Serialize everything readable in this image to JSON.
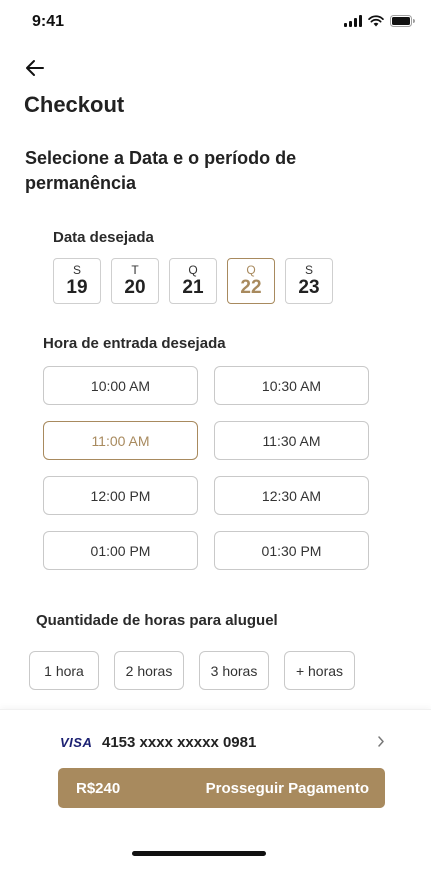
{
  "status_bar": {
    "time": "9:41"
  },
  "header": {
    "title": "Checkout"
  },
  "section": {
    "title": "Selecione a Data e o período de permanência"
  },
  "date_picker": {
    "label": "Data desejada",
    "dates": [
      {
        "dow": "S",
        "day": "19",
        "selected": false
      },
      {
        "dow": "T",
        "day": "20",
        "selected": false
      },
      {
        "dow": "Q",
        "day": "21",
        "selected": false
      },
      {
        "dow": "Q",
        "day": "22",
        "selected": true
      },
      {
        "dow": "S",
        "day": "23",
        "selected": false
      }
    ]
  },
  "time_picker": {
    "label": "Hora de entrada desejada",
    "times": [
      {
        "label": "10:00 AM",
        "selected": false
      },
      {
        "label": "10:30 AM",
        "selected": false
      },
      {
        "label": "11:00 AM",
        "selected": true
      },
      {
        "label": "11:30 AM",
        "selected": false
      },
      {
        "label": "12:00 PM",
        "selected": false
      },
      {
        "label": "12:30 AM",
        "selected": false
      },
      {
        "label": "01:00 PM",
        "selected": false
      },
      {
        "label": "01:30 PM",
        "selected": false
      }
    ]
  },
  "hours_picker": {
    "label": "Quantidade de horas para aluguel",
    "options": [
      "1 hora",
      "2 horas",
      "3 horas",
      "+ horas"
    ]
  },
  "payment": {
    "card_brand": "VISA",
    "card_number": "4153 xxxx xxxxx 0981",
    "price": "R$240",
    "button_label": "Prosseguir Pagamento"
  },
  "colors": {
    "accent": "#a88a5e",
    "text": "#222222",
    "border": "#c9c9c9"
  }
}
